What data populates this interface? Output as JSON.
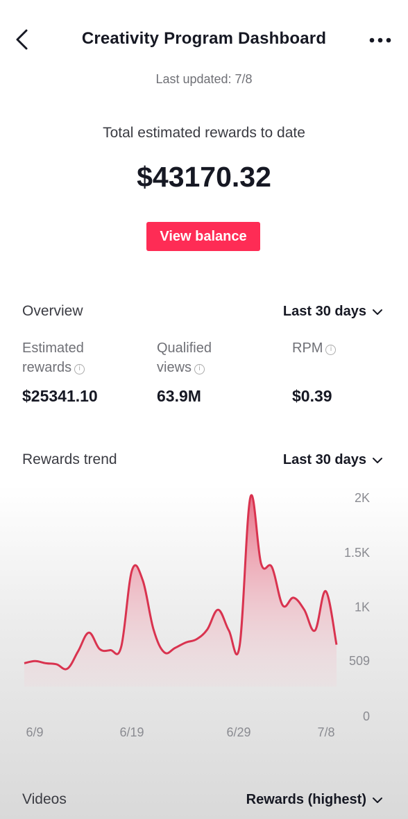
{
  "header": {
    "title": "Creativity Program Dashboard",
    "last_updated": "Last updated: 7/8"
  },
  "summary": {
    "total_label": "Total estimated rewards to date",
    "total_value": "$43170.32",
    "view_balance": "View balance"
  },
  "overview": {
    "title": "Overview",
    "range": "Last 30 days",
    "metrics": [
      {
        "label_line1": "Estimated",
        "label_line2": "rewards",
        "value": "$25341.10"
      },
      {
        "label_line1": "Qualified",
        "label_line2": "views",
        "value": "63.9M"
      },
      {
        "label_line1": "RPM",
        "label_line2": "",
        "value": "$0.39"
      }
    ]
  },
  "trend": {
    "title": "Rewards trend",
    "range": "Last 30 days"
  },
  "videos": {
    "title": "Videos",
    "sort": "Rewards (highest)"
  },
  "colors": {
    "accent": "#fe2c55",
    "line": "#d9334f"
  },
  "chart_data": {
    "type": "area",
    "y_ticks": [
      "2K",
      "1.5K",
      "1K",
      "509",
      "0"
    ],
    "y_tick_values": [
      2000,
      1500,
      1000,
      509,
      0
    ],
    "ylim": [
      0,
      2000
    ],
    "x_tick_labels": [
      "6/9",
      "6/19",
      "6/29",
      "7/8"
    ],
    "x_tick_days": [
      0,
      10,
      20,
      29
    ],
    "series": [
      {
        "values": [
          [
            0,
            480
          ],
          [
            1,
            500
          ],
          [
            2,
            480
          ],
          [
            3,
            470
          ],
          [
            4,
            430
          ],
          [
            5,
            590
          ],
          [
            6,
            760
          ],
          [
            7,
            610
          ],
          [
            8,
            600
          ],
          [
            9,
            630
          ],
          [
            10,
            1330
          ],
          [
            11,
            1240
          ],
          [
            12,
            790
          ],
          [
            13,
            580
          ],
          [
            14,
            620
          ],
          [
            15,
            670
          ],
          [
            16,
            700
          ],
          [
            17,
            790
          ],
          [
            18,
            970
          ],
          [
            19,
            780
          ],
          [
            20,
            640
          ],
          [
            21,
            2000
          ],
          [
            22,
            1390
          ],
          [
            23,
            1360
          ],
          [
            24,
            1010
          ],
          [
            25,
            1080
          ],
          [
            26,
            970
          ],
          [
            27,
            780
          ],
          [
            28,
            1140
          ],
          [
            29,
            650
          ]
        ]
      }
    ]
  }
}
